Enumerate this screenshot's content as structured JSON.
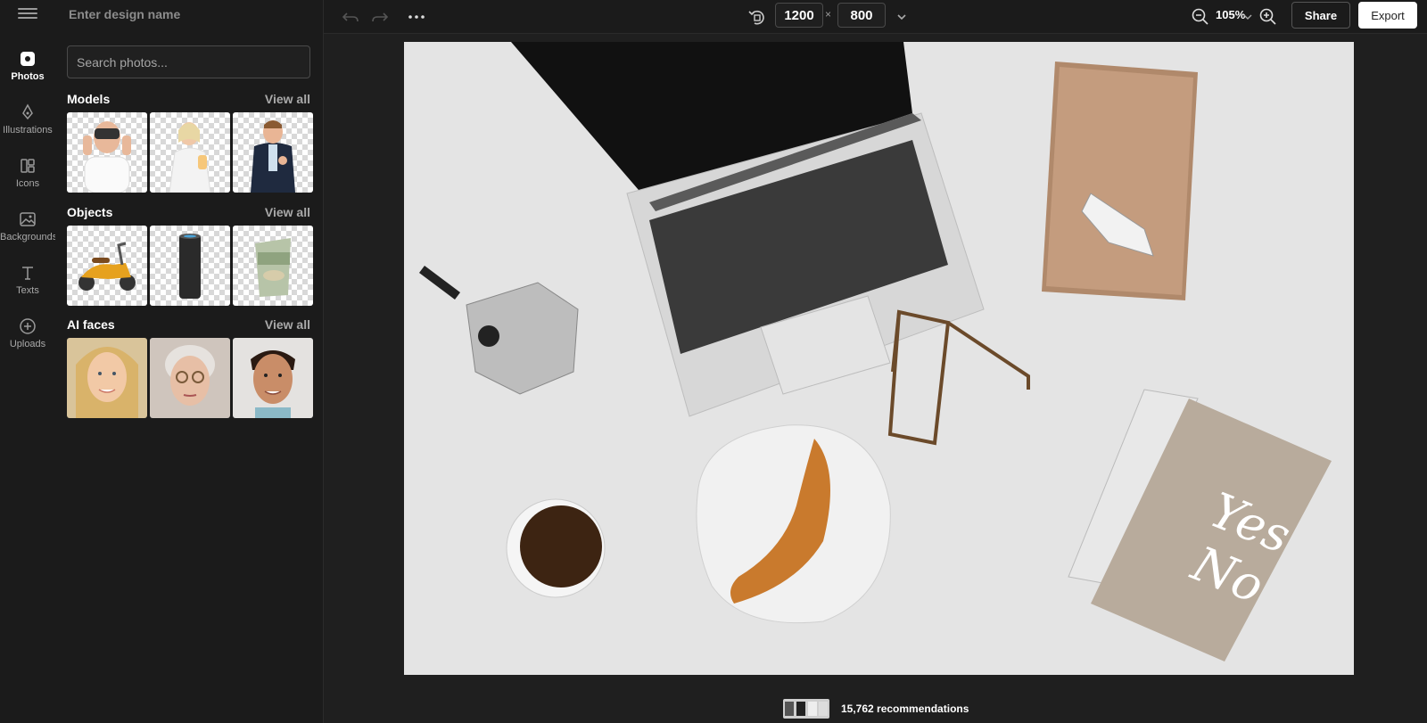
{
  "header": {
    "design_name_placeholder": "Enter design name",
    "width": "1200",
    "height": "800",
    "times": "×",
    "zoom": "105%",
    "share_label": "Share",
    "export_label": "Export"
  },
  "rail": {
    "items": [
      {
        "label": "Photos",
        "icon": "photo-icon",
        "active": true
      },
      {
        "label": "Illustrations",
        "icon": "pen-icon",
        "active": false
      },
      {
        "label": "Icons",
        "icon": "shapes-icon",
        "active": false
      },
      {
        "label": "Backgrounds",
        "icon": "image-icon",
        "active": false
      },
      {
        "label": "Texts",
        "icon": "text-icon",
        "active": false
      },
      {
        "label": "Uploads",
        "icon": "upload-icon",
        "active": false
      }
    ]
  },
  "panel": {
    "search_placeholder": "Search photos...",
    "sections": [
      {
        "title": "Models",
        "link": "View all"
      },
      {
        "title": "Objects",
        "link": "View all"
      },
      {
        "title": "AI faces",
        "link": "View all"
      }
    ]
  },
  "bottom": {
    "recommendations": "15,762 recommendations"
  },
  "colors": {
    "background": "#1f1f1f",
    "panel": "#1b1b1b",
    "canvas": "#e4e4e4",
    "accent_button": "#ffffff"
  }
}
